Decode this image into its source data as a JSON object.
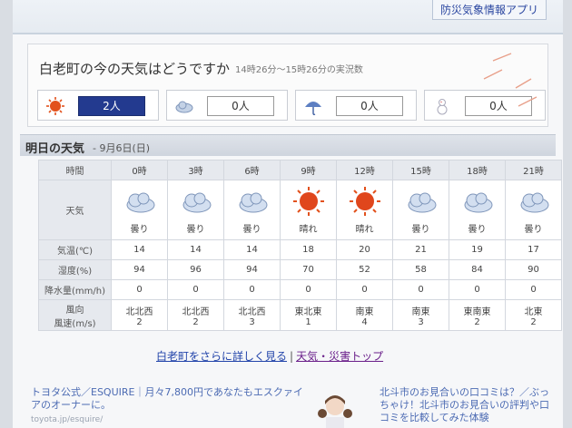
{
  "banner": {
    "link_text": "防災気象情報アプリ"
  },
  "current": {
    "title": "白老町の今の天気はどうですか",
    "subtitle": "14時26分〜15時26分の実況数",
    "votes": [
      {
        "icon": "sun-icon",
        "count": "2人"
      },
      {
        "icon": "cloud-icon",
        "count": "0人"
      },
      {
        "icon": "umbrella-icon",
        "count": "0人"
      },
      {
        "icon": "snowman-icon",
        "count": "0人"
      }
    ]
  },
  "tomorrow": {
    "heading": "明日の天気",
    "date": "- 9月6日(日)"
  },
  "table": {
    "labels": {
      "time": "時間",
      "weather": "天気",
      "temp": "気温(℃)",
      "humidity": "湿度(%)",
      "precip": "降水量(mm/h)",
      "wind_dir": "風向",
      "wind_speed": "風速(m/s)"
    },
    "hours": [
      "0時",
      "3時",
      "6時",
      "9時",
      "12時",
      "15時",
      "18時",
      "21時"
    ],
    "weather": [
      {
        "icon": "cloud-icon",
        "text": "曇り"
      },
      {
        "icon": "cloud-icon",
        "text": "曇り"
      },
      {
        "icon": "cloud-icon",
        "text": "曇り"
      },
      {
        "icon": "sun-icon",
        "text": "晴れ"
      },
      {
        "icon": "sun-icon",
        "text": "晴れ"
      },
      {
        "icon": "cloud-icon",
        "text": "曇り"
      },
      {
        "icon": "cloud-icon",
        "text": "曇り"
      },
      {
        "icon": "cloud-icon",
        "text": "曇り"
      }
    ],
    "temp": [
      "14",
      "14",
      "14",
      "18",
      "20",
      "21",
      "19",
      "17"
    ],
    "humidity": [
      "94",
      "96",
      "94",
      "70",
      "52",
      "58",
      "84",
      "90"
    ],
    "precip": [
      "0",
      "0",
      "0",
      "0",
      "0",
      "0",
      "0",
      "0"
    ],
    "wind_dir": [
      "北北西",
      "北北西",
      "北北西",
      "東北東",
      "南東",
      "南東",
      "東南東",
      "北東"
    ],
    "wind_speed": [
      "2",
      "2",
      "3",
      "1",
      "4",
      "3",
      "2",
      "2"
    ]
  },
  "links": {
    "detail": "白老町をさらに詳しく見る",
    "separator": "|",
    "top": "天気・災害トップ"
  },
  "ads": {
    "left_text": "トヨタ公式／ESQUIRE｜月々7,800円であなたもエスクァイアのオーナーに。",
    "left_url": "toyota.jp/esquire/",
    "right_text": "北斗市のお見合いの口コミは？／ぶっちゃけ！北斗市のお見合いの評判や口コミを比較してみた体験"
  },
  "colors": {
    "accent": "#233a8f",
    "sun": "#e2511c",
    "cloud": "#8aa4c8"
  }
}
